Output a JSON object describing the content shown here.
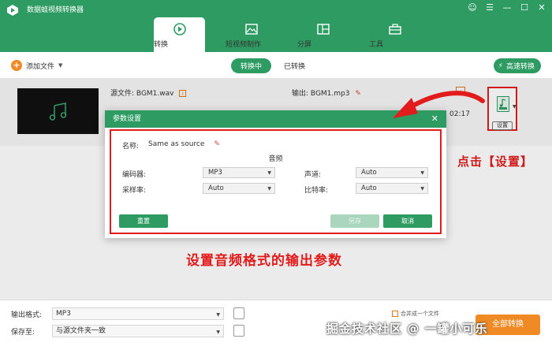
{
  "app": {
    "title": "数据蛙视频转换器"
  },
  "window_controls": [
    "☺",
    "☰",
    "—",
    "☐",
    "✕"
  ],
  "tabs": [
    {
      "label": "转换",
      "active": true
    },
    {
      "label": "短视频制作",
      "active": false
    },
    {
      "label": "分屏",
      "active": false
    },
    {
      "label": "工具",
      "active": false
    }
  ],
  "toolbar": {
    "add_file": "添加文件",
    "converting": "转换中",
    "converted": "已转换",
    "fast_convert": "高速转换"
  },
  "file": {
    "source_label": "源文件:",
    "source_name": "BGM1.wav",
    "output_label": "输出:",
    "output_name": "BGM1.mp3",
    "duration": "02:17",
    "settings_button": "设置"
  },
  "callout": "点击【设置】",
  "dialog": {
    "title": "参数设置",
    "name_label": "名称:",
    "name_value": "Same as source",
    "section": "音频",
    "encoder_label": "编码器:",
    "encoder_value": "MP3",
    "channel_label": "声道:",
    "channel_value": "Auto",
    "samplerate_label": "采样率:",
    "samplerate_value": "Auto",
    "bitrate_label": "比特率:",
    "bitrate_value": "Auto",
    "reset": "重置",
    "save": "另存",
    "cancel": "取消"
  },
  "caption": "设置音频格式的输出参数",
  "bottom": {
    "format_label": "输出格式:",
    "format_value": "MP3",
    "save_label": "保存至:",
    "save_value": "与源文件夹一致",
    "merge_label": "合并成一个文件",
    "convert_button": "全部转换"
  },
  "watermark": "掘金技术社区 @ 一罐小可乐",
  "colors": {
    "brand": "#2e9c62",
    "accent": "#f08a24",
    "annotation": "#e21c1c"
  }
}
